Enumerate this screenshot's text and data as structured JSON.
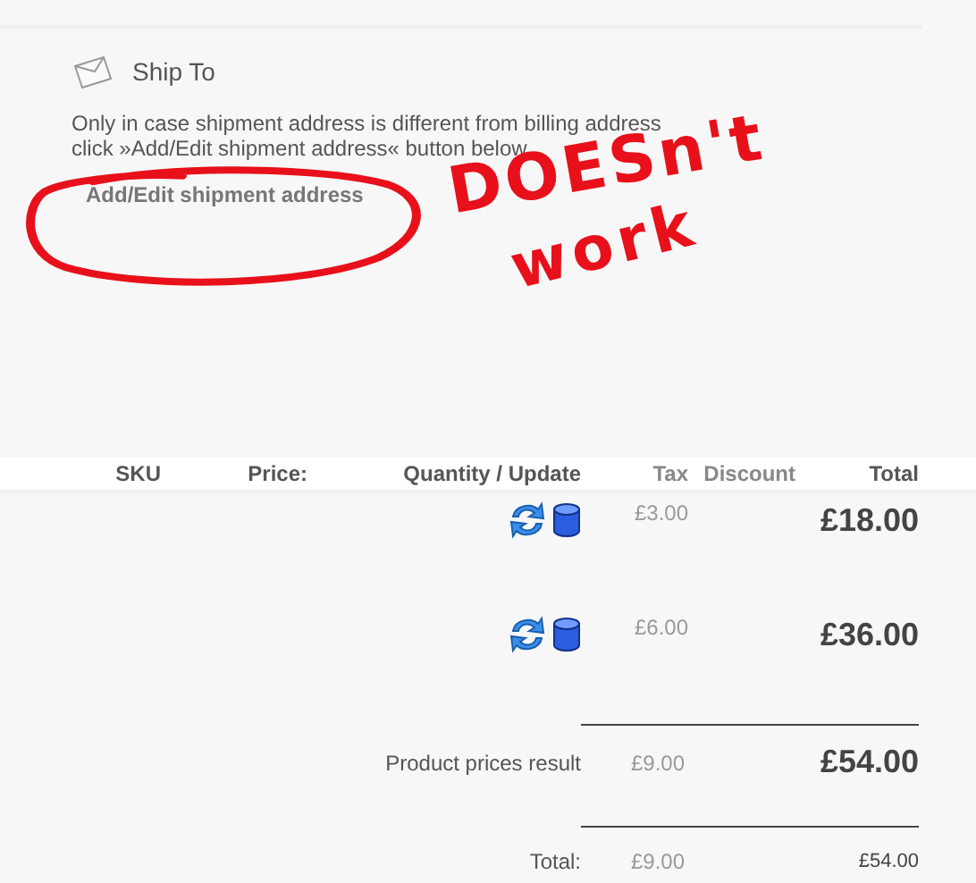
{
  "ship_to": {
    "title": "Ship To",
    "note": "Only in case shipment address is different from billing address",
    "note_2": "click »Add/Edit shipment address« button below",
    "button": "Add/Edit shipment address"
  },
  "annotation": {
    "lines": [
      "DOESn't",
      "work"
    ]
  },
  "table": {
    "columns": [
      "SKU",
      "Price:",
      "Quantity / Update",
      "Tax",
      "Discount",
      "Total"
    ],
    "rows": [
      {
        "tax": "£3.00",
        "total": "£18.00"
      },
      {
        "tax": "£6.00",
        "total": "£36.00"
      }
    ]
  },
  "summary": [
    {
      "kind": "subtotal",
      "label": "Product prices result",
      "tax": "£9.00",
      "total": "£54.00"
    },
    {
      "kind": "total",
      "label": "Total:",
      "tax": "£9.00",
      "total": "£54.00"
    }
  ]
}
